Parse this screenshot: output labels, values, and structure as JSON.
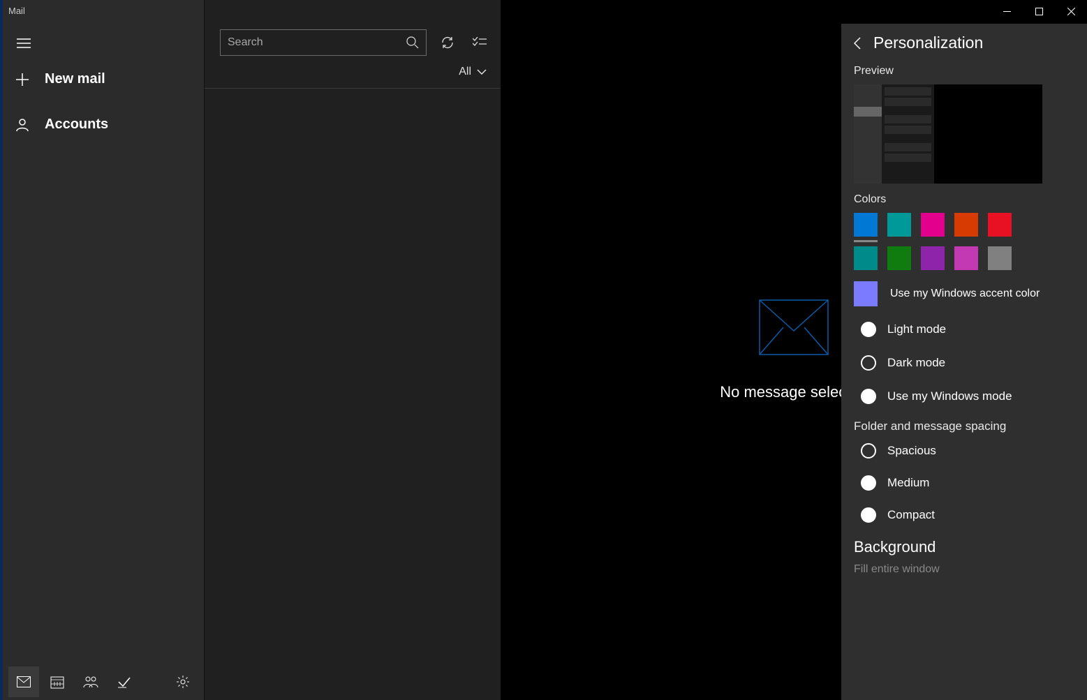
{
  "titlebar": {
    "title": "Mail"
  },
  "sidebar": {
    "new_mail_label": "New mail",
    "accounts_label": "Accounts"
  },
  "search": {
    "placeholder": "Search"
  },
  "filter": {
    "label": "All"
  },
  "content": {
    "empty_message": "No message selected"
  },
  "settings": {
    "title": "Personalization",
    "preview_label": "Preview",
    "colors_label": "Colors",
    "colors": [
      "#0078d4",
      "#009999",
      "#e3008c",
      "#d83b01",
      "#e81123",
      "#008b8b",
      "#107c10",
      "#8e24aa",
      "#c239b3",
      "#808080"
    ],
    "windows_accent_color": "#7b7bff",
    "windows_accent_label": "Use my Windows accent color",
    "mode_options": {
      "light": "Light mode",
      "dark": "Dark mode",
      "windows": "Use my Windows mode"
    },
    "spacing_label": "Folder and message spacing",
    "spacing_options": {
      "spacious": "Spacious",
      "medium": "Medium",
      "compact": "Compact"
    },
    "background_label": "Background",
    "background_value": "Fill entire window"
  }
}
